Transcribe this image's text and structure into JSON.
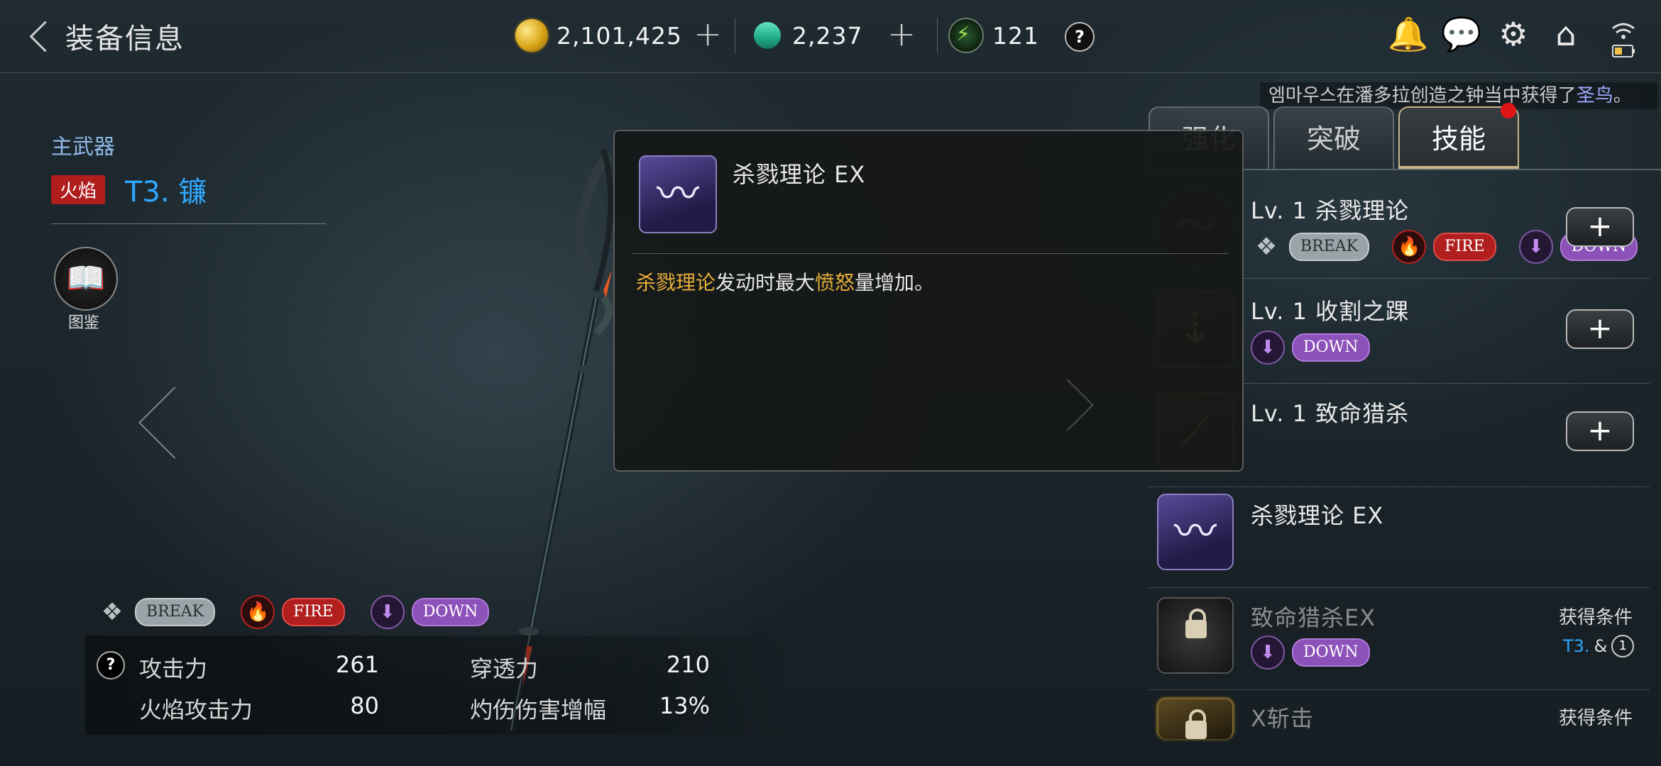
{
  "header": {
    "title": "装备信息",
    "gold": "2,101,425",
    "gems": "2,237",
    "energy": "121",
    "help": "?"
  },
  "notice": {
    "prefix": "엠마우스在潘多拉创造之钟当中获得了",
    "item": "圣鸟",
    "suffix": "。"
  },
  "weapon": {
    "category": "主武器",
    "element_tag": "火焰",
    "name": "T3. 镰",
    "codex_label": "图鉴",
    "attributes": [
      "BREAK",
      "FIRE",
      "DOWN"
    ],
    "stats": [
      {
        "label": "攻击力",
        "value": "261"
      },
      {
        "label": "穿透力",
        "value": "210"
      },
      {
        "label": "火焰攻击力",
        "value": "80"
      },
      {
        "label": "灼伤伤害增幅",
        "value": "13%"
      }
    ]
  },
  "tabs": [
    "强化",
    "突破",
    "技能"
  ],
  "active_tab": "技能",
  "skills": [
    {
      "name": "Lv. 1 杀戮理论",
      "tags": [
        "BREAK",
        "FIRE",
        "DOWN"
      ],
      "button": "+"
    },
    {
      "name": "Lv. 1 收割之踝",
      "tags": [
        "DOWN"
      ],
      "button": "+"
    },
    {
      "name": "Lv. 1 致命猎杀",
      "tags": [],
      "button": "+"
    },
    {
      "name": "杀戮理论 EX",
      "tags": []
    },
    {
      "name": "致命猎杀EX",
      "tags": [
        "DOWN"
      ],
      "condition_label": "获得条件",
      "condition_value": "T3.",
      "condition_amp": "&",
      "condition_num": "1",
      "locked": true
    },
    {
      "name": "X斩击",
      "condition_label": "获得条件",
      "locked": true
    }
  ],
  "popup": {
    "title": "杀戮理论 EX",
    "desc_hl1": "杀戮理论",
    "desc_mid": "发动时最大",
    "desc_hl2": "愤怒",
    "desc_end": "量增加。"
  },
  "colors": {
    "accent_blue": "#2fa8ff",
    "fire_red": "#b11e1e",
    "down_purple": "#8c52b9",
    "highlight_gold": "#e7b03a",
    "tab_active_border": "#c9b48a"
  }
}
